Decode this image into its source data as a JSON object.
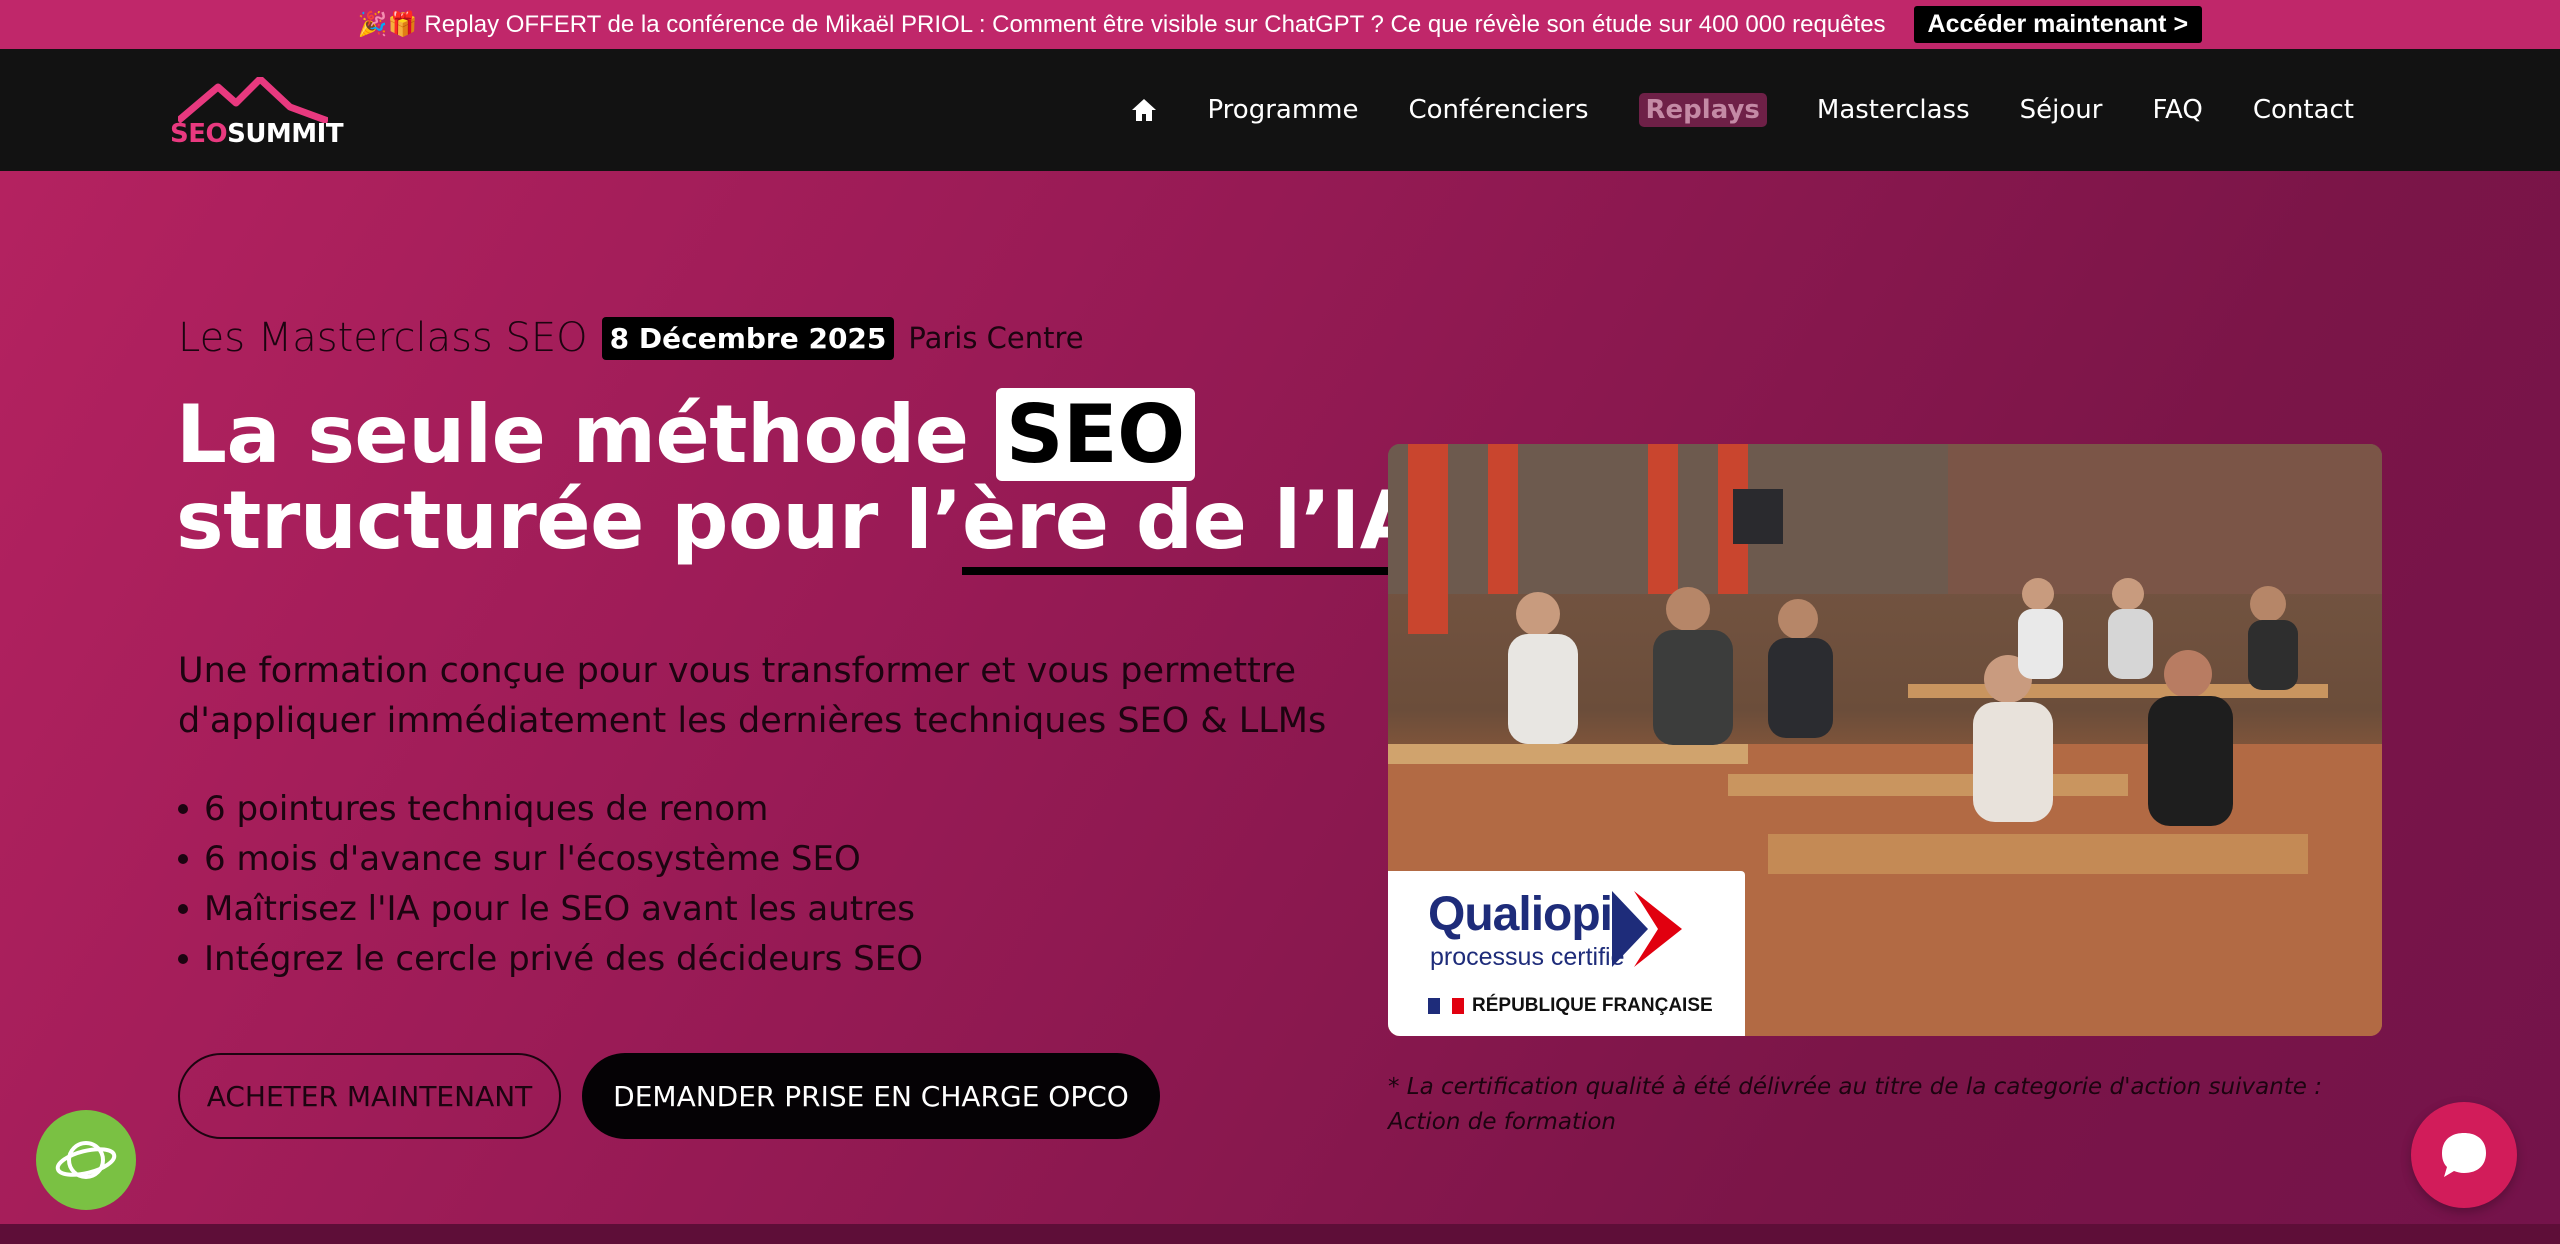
{
  "announcement": {
    "text": "🎉🎁 Replay OFFERT de la conférence de Mikaël PRIOL : Comment être visible sur ChatGPT ? Ce que révèle son étude sur 400 000 requêtes",
    "cta": "Accéder maintenant >"
  },
  "header": {
    "logo": {
      "part1": "SEO",
      "part2": "SUMMIT"
    },
    "nav": [
      {
        "label": "Programme"
      },
      {
        "label": "Conférenciers"
      },
      {
        "label": "Replays",
        "active": true
      },
      {
        "label": "Masterclass"
      },
      {
        "label": "Séjour"
      },
      {
        "label": "FAQ"
      },
      {
        "label": "Contact"
      }
    ]
  },
  "hero": {
    "eyebrow": {
      "lead": "Les Masterclass SEO",
      "date": "8 Décembre 2025",
      "location": "Paris Centre"
    },
    "headline": {
      "line1_start": "La seule méthode ",
      "line1_boxed": "SEO",
      "line2_start": "structurée pour l’",
      "line2_underlined": "ère de l’IA"
    },
    "subtitle_line1": "Une formation conçue pour vous transformer et vous permettre",
    "subtitle_line2": "d'appliquer immédiatement les dernières techniques SEO & LLMs",
    "bullets": [
      "6 pointures techniques de renom",
      "6 mois d'avance sur l'écosystème SEO",
      "Maîtrisez l'IA pour le SEO avant les autres",
      "Intégrez le cercle privé des décideurs SEO"
    ],
    "buttons": {
      "buy": "ACHETER MAINTENANT",
      "opco": "DEMANDER PRISE EN CHARGE OPCO"
    },
    "qualiopi": {
      "title": "Qualiopi",
      "subtitle": "processus certifié",
      "republic": "RÉPUBLIQUE FRANÇAISE"
    },
    "note": "* La certification qualité à été délivrée au titre de la categorie d'action suivante : Action de formation"
  },
  "colors": {
    "accent": "#c0276a",
    "hero_dark": "#7b1548",
    "header_bg": "#121212",
    "chat": "#d21c5a",
    "badge": "#7ac143"
  },
  "icons": [
    "home-icon",
    "seo-summit-mountain-icon",
    "qualiopi-flag-icon",
    "badge-planet-icon",
    "chat-bubble-icon"
  ]
}
